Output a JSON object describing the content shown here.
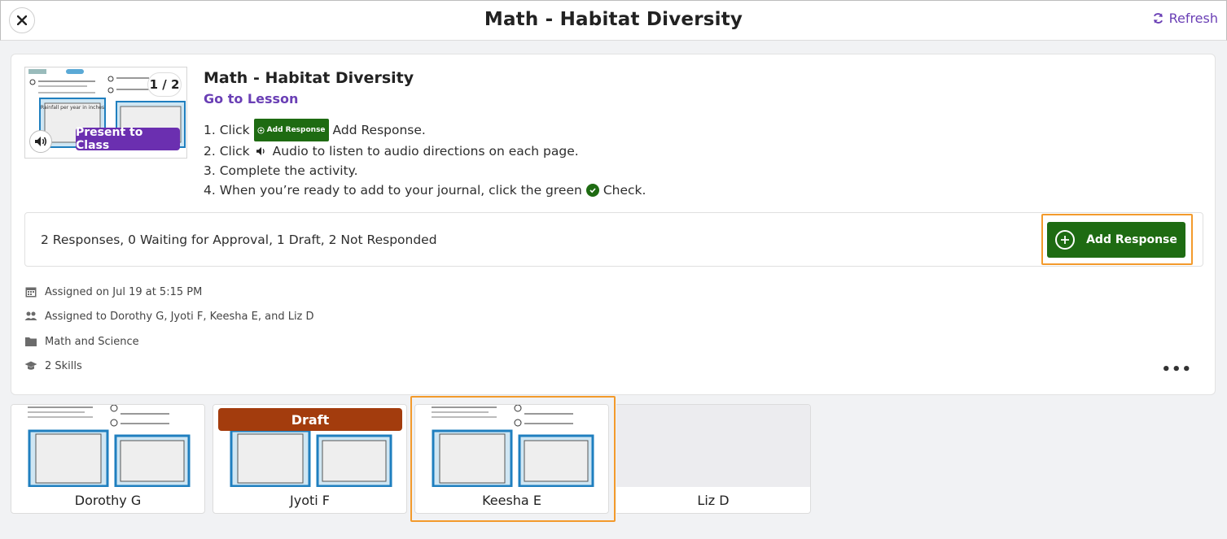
{
  "header": {
    "title": "Math - Habitat Diversity",
    "refresh_label": "Refresh"
  },
  "lesson": {
    "title": "Math - Habitat Diversity",
    "go_to_lesson": "Go to Lesson",
    "page_counter": "1 / 2",
    "present_label": "Present to Class",
    "thumb_chart_title": "Rainfall per year in inches",
    "instructions": {
      "step1_pre": "1. Click",
      "step1_badge": "Add Response",
      "step1_post": "Add Response.",
      "step2_pre": "2. Click",
      "step2_post": "Audio to listen to audio directions on each page.",
      "step3": "3. Complete the activity.",
      "step4_pre": "4. When you’re ready to add to your journal, click the green",
      "step4_post": "Check."
    }
  },
  "status": {
    "summary": "2 Responses, 0 Waiting for Approval, 1 Draft, 2 Not Responded",
    "add_response_label": "Add Response"
  },
  "meta": {
    "assigned_on": "Assigned on Jul 19 at 5:15 PM",
    "assigned_to": "Assigned to Dorothy G, Jyoti F, Keesha E, and Liz D",
    "folder": "Math and Science",
    "skills": "2 Skills"
  },
  "students": [
    {
      "name": "Dorothy G"
    },
    {
      "name": "Jyoti F",
      "badge": "Draft"
    },
    {
      "name": "Keesha E"
    },
    {
      "name": "Liz D"
    }
  ],
  "colors": {
    "accent_purple": "#6a3fb5",
    "primary_green": "#1e6b12",
    "draft_brown": "#a33c0d",
    "highlight_orange": "#f39a2c"
  }
}
